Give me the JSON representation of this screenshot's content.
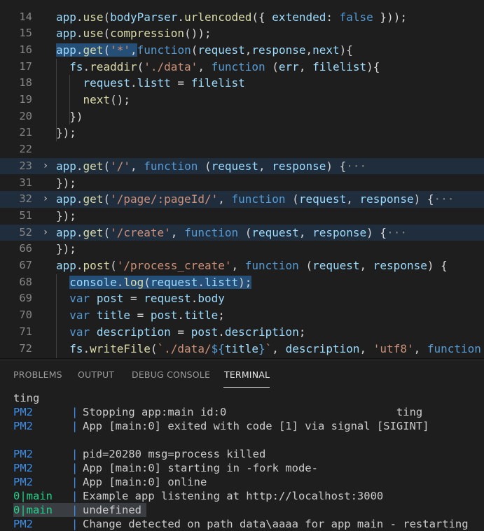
{
  "editor": {
    "lines": [
      {
        "num": "14",
        "tokens": [
          [
            "var",
            "app"
          ],
          [
            "pun",
            "."
          ],
          [
            "fn",
            "use"
          ],
          [
            "pun",
            "("
          ],
          [
            "var",
            "bodyParser"
          ],
          [
            "pun",
            "."
          ],
          [
            "fn",
            "urlencoded"
          ],
          [
            "pun",
            "({ "
          ],
          [
            "var",
            "extended"
          ],
          [
            "pun",
            ": "
          ],
          [
            "bool",
            "false"
          ],
          [
            "pun",
            " }));"
          ]
        ]
      },
      {
        "num": "15",
        "tokens": [
          [
            "var",
            "app"
          ],
          [
            "pun",
            "."
          ],
          [
            "fn",
            "use"
          ],
          [
            "pun",
            "("
          ],
          [
            "fn",
            "compression"
          ],
          [
            "pun",
            "());"
          ]
        ]
      },
      {
        "num": "16",
        "tokens": [
          [
            "var",
            "app"
          ],
          [
            "pun",
            "."
          ],
          [
            "fn",
            "get"
          ],
          [
            "pun",
            "("
          ],
          [
            "str",
            "'*'"
          ],
          [
            "pun",
            ","
          ],
          [
            "kw",
            "function"
          ],
          [
            "pun",
            "("
          ],
          [
            "var",
            "request"
          ],
          [
            "pun",
            ","
          ],
          [
            "var",
            "response"
          ],
          [
            "pun",
            ","
          ],
          [
            "var",
            "next"
          ],
          [
            "pun",
            "){"
          ]
        ]
      },
      {
        "num": "17",
        "tokens": [
          [
            "pun",
            "  "
          ],
          [
            "var",
            "fs"
          ],
          [
            "pun",
            "."
          ],
          [
            "fn",
            "readdir"
          ],
          [
            "pun",
            "("
          ],
          [
            "str",
            "'./data'"
          ],
          [
            "pun",
            ", "
          ],
          [
            "kw",
            "function"
          ],
          [
            "pun",
            " ("
          ],
          [
            "var",
            "err"
          ],
          [
            "pun",
            ", "
          ],
          [
            "var",
            "filelist"
          ],
          [
            "pun",
            "){"
          ]
        ]
      },
      {
        "num": "18",
        "tokens": [
          [
            "pun",
            "    "
          ],
          [
            "var",
            "request"
          ],
          [
            "pun",
            "."
          ],
          [
            "var",
            "listt"
          ],
          [
            "pun",
            " = "
          ],
          [
            "var",
            "filelist"
          ]
        ]
      },
      {
        "num": "19",
        "tokens": [
          [
            "pun",
            "    "
          ],
          [
            "fn",
            "next"
          ],
          [
            "pun",
            "();"
          ]
        ]
      },
      {
        "num": "20",
        "tokens": [
          [
            "pun",
            "  })"
          ]
        ]
      },
      {
        "num": "21",
        "tokens": [
          [
            "pun",
            "});"
          ]
        ]
      },
      {
        "num": "22",
        "tokens": []
      },
      {
        "num": "23",
        "fold": "›",
        "hl": true,
        "tokens": [
          [
            "var",
            "app"
          ],
          [
            "pun",
            "."
          ],
          [
            "fn",
            "get"
          ],
          [
            "pun",
            "("
          ],
          [
            "str",
            "'/'"
          ],
          [
            "pun",
            ", "
          ],
          [
            "kw",
            "function"
          ],
          [
            "pun",
            " ("
          ],
          [
            "var",
            "request"
          ],
          [
            "pun",
            ", "
          ],
          [
            "var",
            "response"
          ],
          [
            "pun",
            ") {"
          ],
          [
            "ell",
            "···"
          ]
        ]
      },
      {
        "num": "31",
        "tokens": [
          [
            "pun",
            "});"
          ]
        ]
      },
      {
        "num": "32",
        "fold": "›",
        "hl": true,
        "tokens": [
          [
            "var",
            "app"
          ],
          [
            "pun",
            "."
          ],
          [
            "fn",
            "get"
          ],
          [
            "pun",
            "("
          ],
          [
            "str",
            "'/page/:pageId/'"
          ],
          [
            "pun",
            ", "
          ],
          [
            "kw",
            "function"
          ],
          [
            "pun",
            " ("
          ],
          [
            "var",
            "request"
          ],
          [
            "pun",
            ", "
          ],
          [
            "var",
            "response"
          ],
          [
            "pun",
            ") {"
          ],
          [
            "ell",
            "···"
          ]
        ]
      },
      {
        "num": "51",
        "tokens": [
          [
            "pun",
            "});"
          ]
        ]
      },
      {
        "num": "52",
        "fold": "›",
        "hl": true,
        "tokens": [
          [
            "var",
            "app"
          ],
          [
            "pun",
            "."
          ],
          [
            "fn",
            "get"
          ],
          [
            "pun",
            "("
          ],
          [
            "str",
            "'/create'"
          ],
          [
            "pun",
            ", "
          ],
          [
            "kw",
            "function"
          ],
          [
            "pun",
            " ("
          ],
          [
            "var",
            "request"
          ],
          [
            "pun",
            ", "
          ],
          [
            "var",
            "response"
          ],
          [
            "pun",
            ") {"
          ],
          [
            "ell",
            "···"
          ]
        ]
      },
      {
        "num": "66",
        "tokens": [
          [
            "pun",
            "});"
          ]
        ]
      },
      {
        "num": "67",
        "tokens": [
          [
            "var",
            "app"
          ],
          [
            "pun",
            "."
          ],
          [
            "fn",
            "post"
          ],
          [
            "pun",
            "("
          ],
          [
            "str",
            "'/process_create'"
          ],
          [
            "pun",
            ", "
          ],
          [
            "kw",
            "function"
          ],
          [
            "pun",
            " ("
          ],
          [
            "var",
            "request"
          ],
          [
            "pun",
            ", "
          ],
          [
            "var",
            "response"
          ],
          [
            "pun",
            ") {"
          ]
        ]
      },
      {
        "num": "68",
        "tokens": [
          [
            "pun",
            "  "
          ],
          [
            "var",
            "console"
          ],
          [
            "pun",
            "."
          ],
          [
            "fn",
            "log"
          ],
          [
            "pun",
            "("
          ],
          [
            "var",
            "request"
          ],
          [
            "pun",
            "."
          ],
          [
            "var",
            "listt"
          ],
          [
            "pun",
            ");"
          ]
        ]
      },
      {
        "num": "69",
        "tokens": [
          [
            "pun",
            "  "
          ],
          [
            "kw",
            "var"
          ],
          [
            "pun",
            " "
          ],
          [
            "var",
            "post"
          ],
          [
            "pun",
            " = "
          ],
          [
            "var",
            "request"
          ],
          [
            "pun",
            "."
          ],
          [
            "var",
            "body"
          ]
        ]
      },
      {
        "num": "70",
        "tokens": [
          [
            "pun",
            "  "
          ],
          [
            "kw",
            "var"
          ],
          [
            "pun",
            " "
          ],
          [
            "var",
            "title"
          ],
          [
            "pun",
            " = "
          ],
          [
            "var",
            "post"
          ],
          [
            "pun",
            "."
          ],
          [
            "var",
            "title"
          ],
          [
            "pun",
            ";"
          ]
        ]
      },
      {
        "num": "71",
        "tokens": [
          [
            "pun",
            "  "
          ],
          [
            "kw",
            "var"
          ],
          [
            "pun",
            " "
          ],
          [
            "var",
            "description"
          ],
          [
            "pun",
            " = "
          ],
          [
            "var",
            "post"
          ],
          [
            "pun",
            "."
          ],
          [
            "var",
            "description"
          ],
          [
            "pun",
            ";"
          ]
        ]
      },
      {
        "num": "72",
        "tokens": [
          [
            "pun",
            "  "
          ],
          [
            "var",
            "fs"
          ],
          [
            "pun",
            "."
          ],
          [
            "fn",
            "writeFile"
          ],
          [
            "pun",
            "("
          ],
          [
            "str",
            "`./data/"
          ],
          [
            "kw",
            "${"
          ],
          [
            "var",
            "title"
          ],
          [
            "kw",
            "}"
          ],
          [
            "str",
            "`"
          ],
          [
            "pun",
            ", "
          ],
          [
            "var",
            "description"
          ],
          [
            "pun",
            ", "
          ],
          [
            "str",
            "'utf8'"
          ],
          [
            "pun",
            ", "
          ],
          [
            "kw",
            "function"
          ]
        ]
      }
    ]
  },
  "panel": {
    "tabs": [
      "PROBLEMS",
      "OUTPUT",
      "DEBUG CONSOLE",
      "TERMINAL"
    ],
    "active_tab": "TERMINAL"
  },
  "terminal": {
    "lines": [
      {
        "prefix": "",
        "bar": false,
        "text": "ting"
      },
      {
        "prefix": "PM2",
        "bar": true,
        "text": "Stopping app:main id:0                          ting"
      },
      {
        "prefix": "PM2",
        "bar": true,
        "text": "App [main:0] exited with code [1] via signal [SIGINT]"
      },
      {
        "prefix": "",
        "bar": false,
        "text": ""
      },
      {
        "prefix": "PM2",
        "bar": true,
        "text": "pid=20280 msg=process killed"
      },
      {
        "prefix": "PM2",
        "bar": true,
        "text": "App [main:0] starting in -fork mode-"
      },
      {
        "prefix": "PM2",
        "bar": true,
        "text": "App [main:0] online"
      },
      {
        "prefix": "0|main",
        "bar": true,
        "green": true,
        "text": "Example app listening at http://localhost:3000"
      },
      {
        "prefix": "0|main",
        "bar": true,
        "green": true,
        "highlight": true,
        "text": "undefined"
      },
      {
        "prefix": "PM2",
        "bar": true,
        "text": "Change detected on path data\\aaaa for app main - restarting"
      }
    ]
  },
  "colors": {
    "background": "#1e1e1e",
    "keyword": "#569cd6",
    "variable": "#9cdcfe",
    "function": "#dcdcaa",
    "string": "#ce9178",
    "pm2_prefix": "#3b8eea",
    "main_prefix": "#23d18b"
  }
}
